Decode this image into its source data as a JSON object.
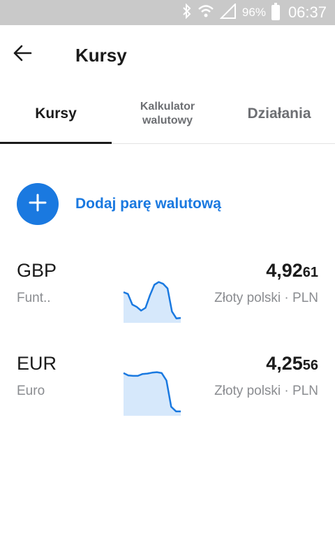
{
  "status_bar": {
    "battery_text": "96%",
    "time": "06:37",
    "icons": [
      "bluetooth-icon",
      "wifi-icon",
      "signal-icon",
      "battery-icon"
    ]
  },
  "header": {
    "title": "Kursy",
    "back_icon": "arrow-left-icon"
  },
  "tabs": [
    {
      "label": "Kursy",
      "active": true
    },
    {
      "label": "Kalkulator walutowy",
      "active": false
    },
    {
      "label": "Działania",
      "active": false
    }
  ],
  "add_pair": {
    "label": "Dodaj parę walutową",
    "icon": "plus-icon"
  },
  "rates": [
    {
      "code": "GBP",
      "name": "Funt..",
      "price_main": "4,92",
      "price_small": "61",
      "quote": "Złoty polski · PLN",
      "trend": [
        0.62,
        0.58,
        0.35,
        0.3,
        0.22,
        0.28,
        0.55,
        0.78,
        0.84,
        0.8,
        0.7,
        0.2,
        0.05,
        0.06
      ]
    },
    {
      "code": "EUR",
      "name": "Euro",
      "price_main": "4,25",
      "price_small": "56",
      "quote": "Złoty polski · PLN",
      "trend": [
        0.88,
        0.83,
        0.82,
        0.82,
        0.86,
        0.87,
        0.89,
        0.9,
        0.88,
        0.72,
        0.15,
        0.05,
        0.05
      ]
    }
  ],
  "colors": {
    "accent": "#1a79e0",
    "chart_fill": "#d6e8fb",
    "muted": "#8a8c90",
    "status_bar": "#c9c9c9"
  }
}
